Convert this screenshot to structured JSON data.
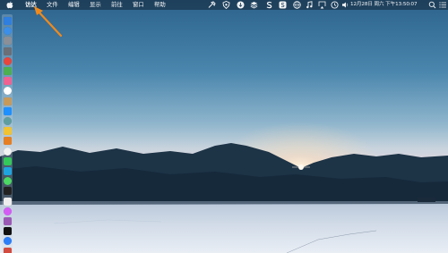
{
  "menubar": {
    "apple_icon": "apple-icon",
    "items": [
      {
        "label": "访达"
      },
      {
        "label": "文件"
      },
      {
        "label": "编辑"
      },
      {
        "label": "显示"
      },
      {
        "label": "前往"
      },
      {
        "label": "窗口"
      },
      {
        "label": "帮助"
      }
    ],
    "status_icons": [
      "hammer-icon",
      "shield-icon",
      "download-icon",
      "stack-icon",
      "s-icon",
      "qq-penguin-icon",
      "skype-icon",
      "globe-icon",
      "music-note-icon",
      "airplay-icon",
      "time-machine-icon",
      "volume-icon"
    ],
    "clock": "12月28日 周六 下午13:50:07"
  },
  "dock": {
    "icons": [
      {
        "name": "finder-icon",
        "color": "#2f7fe0"
      },
      {
        "name": "safari-icon",
        "color": "#3c8fe8"
      },
      {
        "name": "launchpad-icon",
        "color": "#8a8f98"
      },
      {
        "name": "gear-icon",
        "color": "#6b6f77"
      },
      {
        "name": "chrome-icon",
        "color": "#e8453c"
      },
      {
        "name": "maps-icon",
        "color": "#4caf50"
      },
      {
        "name": "photos-icon",
        "color": "#f06292"
      },
      {
        "name": "calendar-icon",
        "color": "#ffffff"
      },
      {
        "name": "contacts-icon",
        "color": "#c79a5a"
      },
      {
        "name": "app-store-icon",
        "color": "#1e90ff"
      },
      {
        "name": "preview-icon",
        "color": "#5f9ea0"
      },
      {
        "name": "notes-icon",
        "color": "#f1c232"
      },
      {
        "name": "books-icon",
        "color": "#e67e22"
      },
      {
        "name": "reminders-icon",
        "color": "#f2f2f2"
      },
      {
        "name": "facetime-icon",
        "color": "#34c759"
      },
      {
        "name": "edge-icon",
        "color": "#1fa4e0"
      },
      {
        "name": "messages-icon",
        "color": "#4cd964"
      },
      {
        "name": "terminal-icon",
        "color": "#222222"
      },
      {
        "name": "textedit-icon",
        "color": "#eeeeee"
      },
      {
        "name": "itunes-icon",
        "color": "#d45cf5"
      },
      {
        "name": "podcasts-icon",
        "color": "#9b59b6"
      },
      {
        "name": "tv-icon",
        "color": "#111111"
      },
      {
        "name": "xcode-icon",
        "color": "#2d7ff9"
      },
      {
        "name": "trash-icon",
        "color": "#d24b3e"
      }
    ]
  },
  "annotation": {
    "color": "#f08a1c"
  }
}
